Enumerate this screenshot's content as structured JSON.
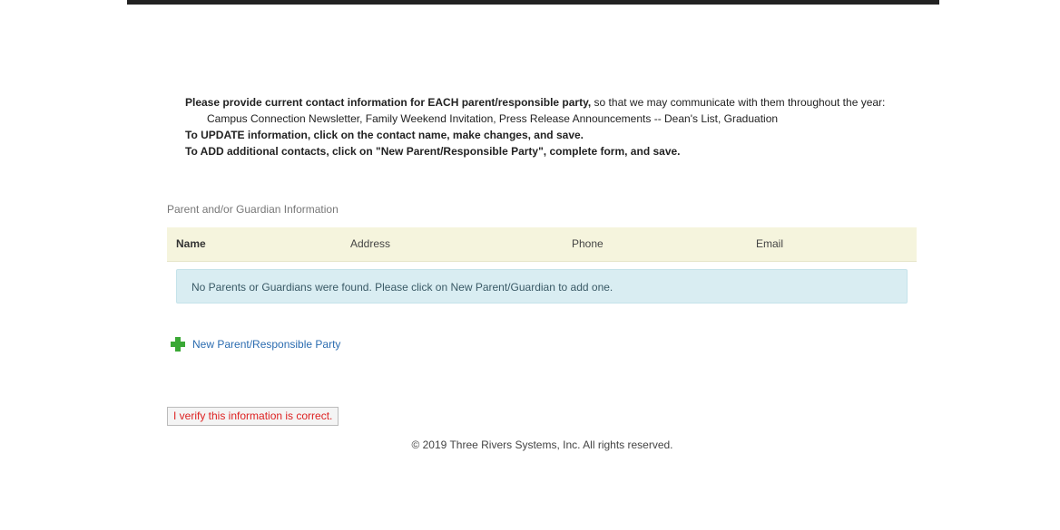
{
  "instructions": {
    "line1_bold": "Please provide current contact information for EACH parent/responsible party,",
    "line1_rest": " so that we may communicate with them throughout the year:",
    "line2": "Campus Connection Newsletter, Family Weekend Invitation, Press Release Announcements -- Dean's List, Graduation",
    "line3": "To UPDATE information, click on the contact name, make changes, and save.",
    "line4": "To ADD additional contacts, click on \"New Parent/Responsible Party\", complete form, and save."
  },
  "section": {
    "title": "Parent and/or Guardian Information"
  },
  "table": {
    "headers": {
      "name": "Name",
      "address": "Address",
      "phone": "Phone",
      "email": "Email"
    },
    "empty_message": "No Parents or Guardians were found. Please click on New Parent/Guardian to add one."
  },
  "actions": {
    "new_party": "New Parent/Responsible Party",
    "verify": "I verify this information is correct."
  },
  "footer": {
    "copyright": "© 2019 Three Rivers Systems, Inc. All rights reserved."
  },
  "colors": {
    "header_bg": "#f5f4dd",
    "alert_bg": "#d9edf2",
    "link": "#2b6cb0",
    "plus": "#3aa835",
    "verify_text": "#dd2222"
  },
  "icons": {
    "new_party": "plus-icon"
  }
}
